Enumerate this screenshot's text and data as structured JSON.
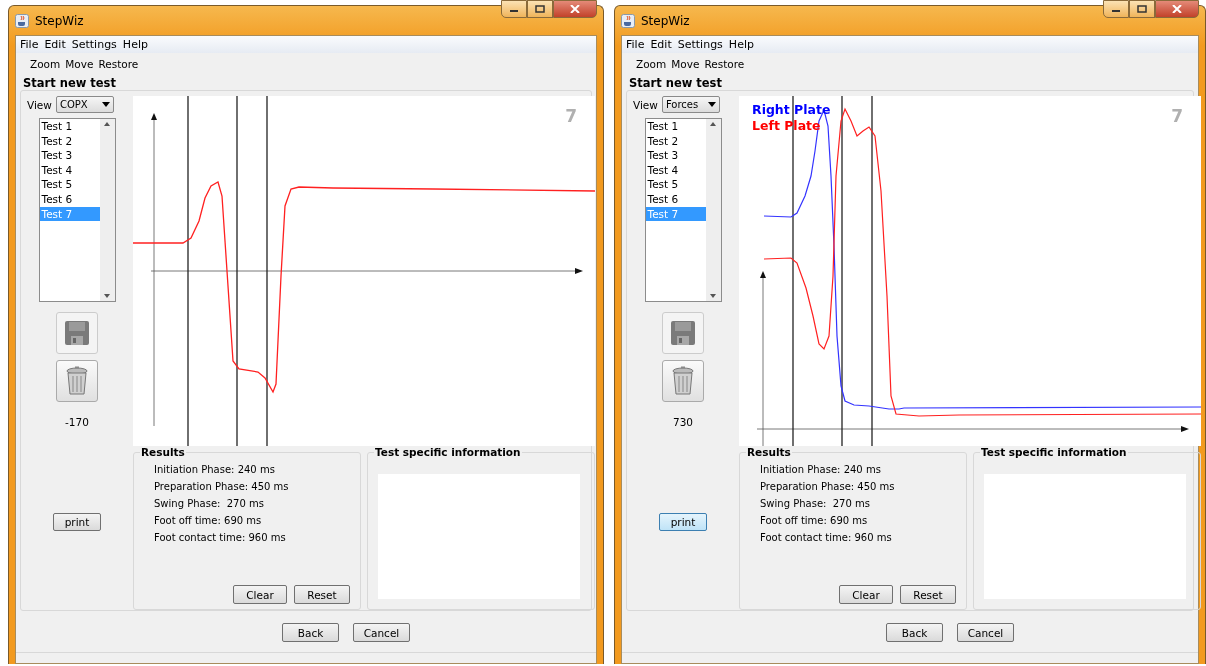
{
  "windows": [
    {
      "title": "StepWiz",
      "menu": [
        "File",
        "Edit",
        "Settings",
        "Help"
      ],
      "toolbar": [
        "Zoom",
        "Move",
        "Restore"
      ],
      "group_title": "Start new test",
      "view_label": "View",
      "view_value": "COPX",
      "tests": [
        {
          "label": "Test 1",
          "selected": false
        },
        {
          "label": "Test 2",
          "selected": false
        },
        {
          "label": "Test 3",
          "selected": false
        },
        {
          "label": "Test 4",
          "selected": false
        },
        {
          "label": "Test 5",
          "selected": false
        },
        {
          "label": "Test 6",
          "selected": false
        },
        {
          "label": "Test 7",
          "selected": true
        }
      ],
      "reading": "-170",
      "print": "print",
      "print_focused": false,
      "chart": {
        "kind": "copx",
        "number": "7"
      },
      "results_title": "Results",
      "results": [
        "Initiation Phase: 240 ms",
        "Preparation Phase: 450 ms",
        "Swing Phase:  270 ms",
        "Foot off time: 690 ms",
        "Foot contact time: 960 ms"
      ],
      "clear": "Clear",
      "reset": "Reset",
      "info_title": "Test specific information",
      "back": "Back",
      "cancel": "Cancel"
    },
    {
      "title": "StepWiz",
      "menu": [
        "File",
        "Edit",
        "Settings",
        "Help"
      ],
      "toolbar": [
        "Zoom",
        "Move",
        "Restore"
      ],
      "group_title": "Start new test",
      "view_label": "View",
      "view_value": "Forces",
      "tests": [
        {
          "label": "Test 1",
          "selected": false
        },
        {
          "label": "Test 2",
          "selected": false
        },
        {
          "label": "Test 3",
          "selected": false
        },
        {
          "label": "Test 4",
          "selected": false
        },
        {
          "label": "Test 5",
          "selected": false
        },
        {
          "label": "Test 6",
          "selected": false
        },
        {
          "label": "Test 7",
          "selected": true
        }
      ],
      "reading": "730",
      "print": "print",
      "print_focused": true,
      "chart": {
        "kind": "forces",
        "number": "7",
        "legend": [
          {
            "label": "Right Plate",
            "color": "#0000ff"
          },
          {
            "label": "Left Plate",
            "color": "#ff0000"
          }
        ]
      },
      "results_title": "Results",
      "results": [
        "Initiation Phase: 240 ms",
        "Preparation Phase: 450 ms",
        "Swing Phase:  270 ms",
        "Foot off time: 690 ms",
        "Foot contact time: 960 ms"
      ],
      "clear": "Clear",
      "reset": "Reset",
      "info_title": "Test specific information",
      "back": "Back",
      "cancel": "Cancel"
    }
  ]
}
